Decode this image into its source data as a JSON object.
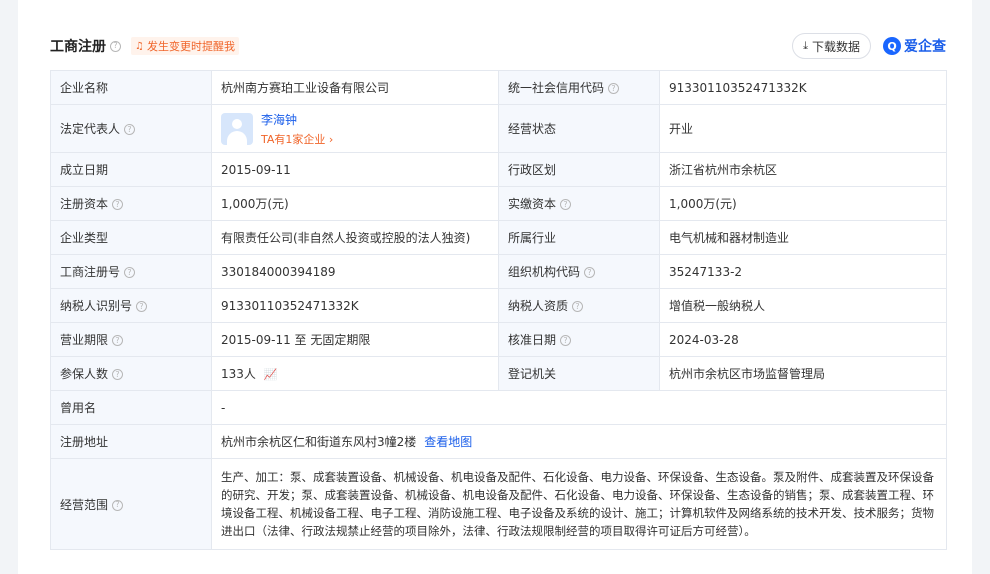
{
  "header": {
    "title": "工商注册",
    "change_tip": "发生变更时提醒我",
    "download_label": "下载数据",
    "brand_logo": "Q",
    "brand_name": "爱企查"
  },
  "rows": {
    "company_name": {
      "label": "企业名称",
      "value": "杭州南方赛珀工业设备有限公司"
    },
    "credit_code": {
      "label": "统一社会信用代码",
      "value": "91330110352471332K"
    },
    "legal_rep": {
      "label": "法定代表人",
      "name": "李海钟",
      "sub": "TA有1家企业 ›"
    },
    "status": {
      "label": "经营状态",
      "value": "开业"
    },
    "established": {
      "label": "成立日期",
      "value": "2015-09-11"
    },
    "district": {
      "label": "行政区划",
      "value": "浙江省杭州市余杭区"
    },
    "reg_capital": {
      "label": "注册资本",
      "value": "1,000万(元)"
    },
    "paid_capital": {
      "label": "实缴资本",
      "value": "1,000万(元)"
    },
    "company_type": {
      "label": "企业类型",
      "value": "有限责任公司(非自然人投资或控股的法人独资)"
    },
    "industry": {
      "label": "所属行业",
      "value": "电气机械和器材制造业"
    },
    "reg_number": {
      "label": "工商注册号",
      "value": "330184000394189"
    },
    "org_code": {
      "label": "组织机构代码",
      "value": "35247133-2"
    },
    "taxpayer_id": {
      "label": "纳税人识别号",
      "value": "91330110352471332K"
    },
    "taxpayer_qual": {
      "label": "纳税人资质",
      "value": "增值税一般纳税人"
    },
    "term": {
      "label": "营业期限",
      "value": "2015-09-11 至 无固定期限"
    },
    "approval_date": {
      "label": "核准日期",
      "value": "2024-03-28"
    },
    "insured": {
      "label": "参保人数",
      "value": "133人"
    },
    "reg_authority": {
      "label": "登记机关",
      "value": "杭州市余杭区市场监督管理局"
    },
    "former_name": {
      "label": "曾用名",
      "value": "-"
    },
    "address": {
      "label": "注册地址",
      "value": "杭州市余杭区仁和街道东风村3幢2楼",
      "map_link": "查看地图"
    },
    "scope": {
      "label": "经营范围",
      "value": "生产、加工：泵、成套装置设备、机械设备、机电设备及配件、石化设备、电力设备、环保设备、生态设备。泵及附件、成套装置及环保设备的研究、开发；泵、成套装置设备、机械设备、机电设备及配件、石化设备、电力设备、环保设备、生态设备的销售；泵、成套装置工程、环境设备工程、机械设备工程、电子工程、消防设施工程、电子设备及系统的设计、施工；计算机软件及网络系统的技术开发、技术服务；货物进出口（法律、行政法规禁止经营的项目除外，法律、行政法规限制经营的项目取得许可证后方可经营）。"
    }
  },
  "icons": {
    "help": "?",
    "bell": "bell-icon",
    "download": "download-icon",
    "trend": "trend-chart-icon"
  },
  "colors": {
    "accent": "#1a5eea",
    "warning": "#f0652a",
    "label_bg": "#f5f8fd",
    "border": "#e4e8ef"
  }
}
